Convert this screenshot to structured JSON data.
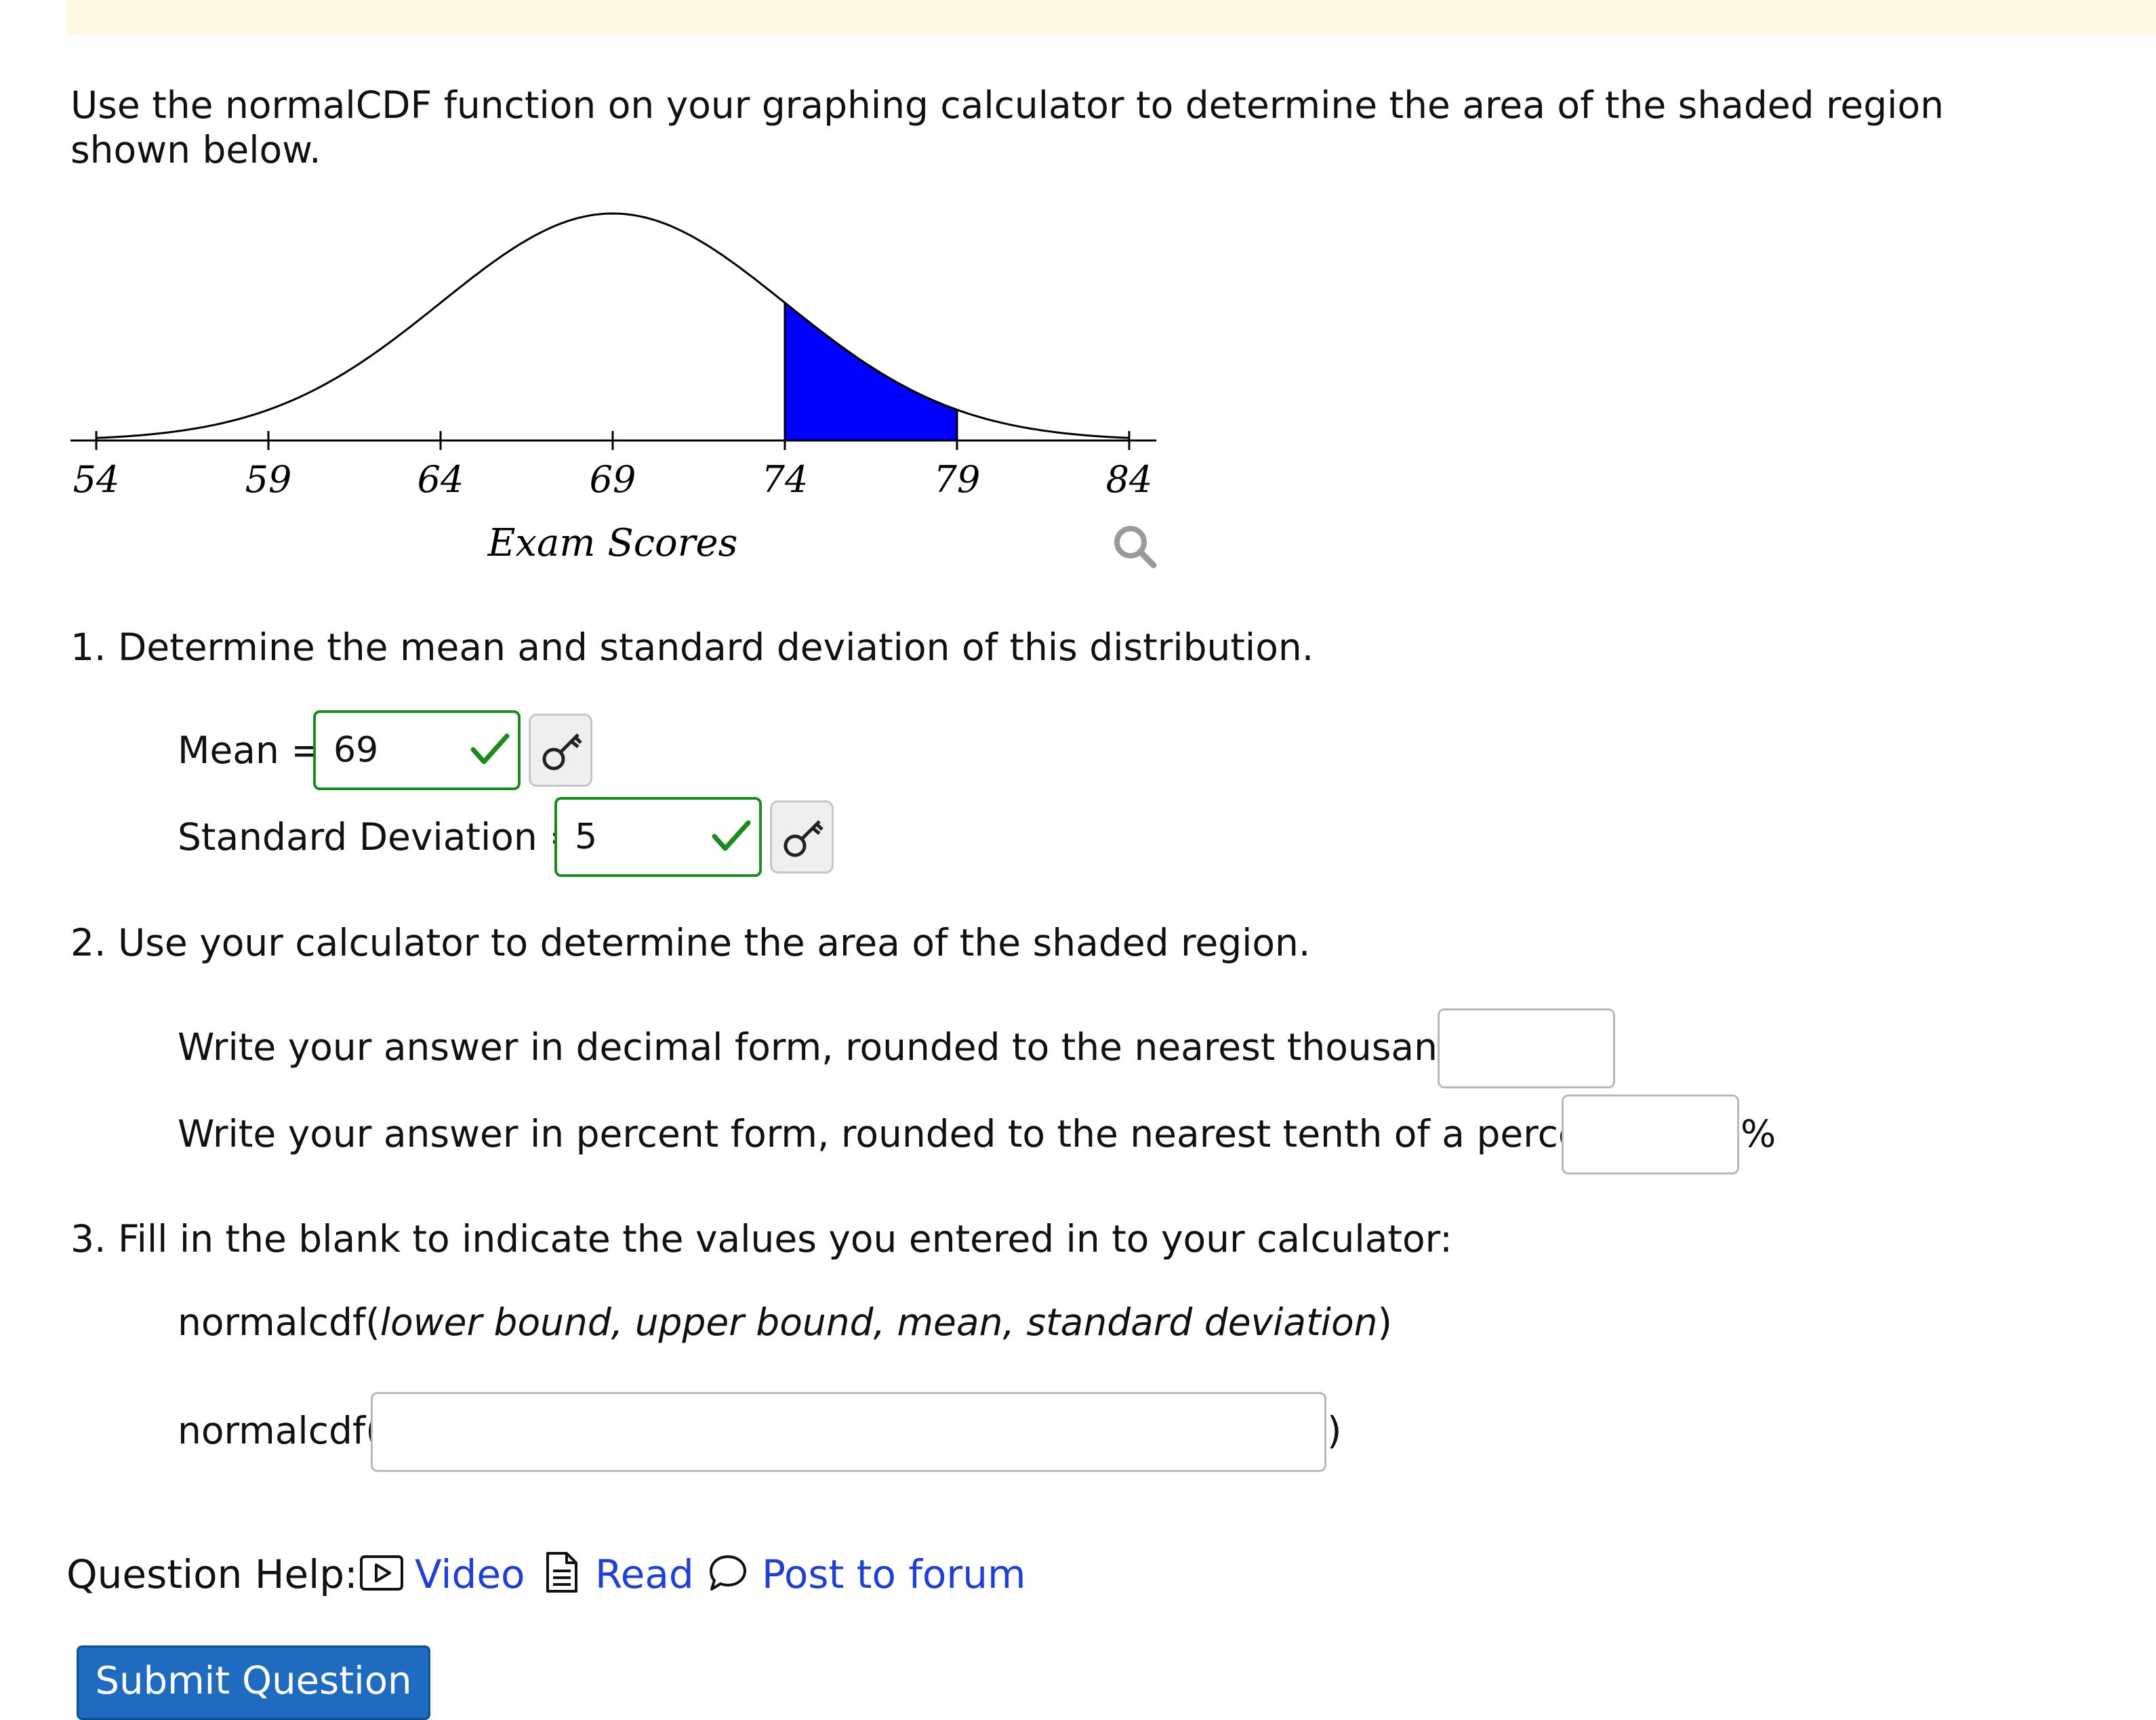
{
  "intro": "Use the normalCDF function on your graphing calculator to determine the area of the shaded region shown below.",
  "chart_data": {
    "type": "area",
    "distribution": "normal",
    "mean": 69,
    "sd": 5,
    "xlim": [
      54,
      84
    ],
    "ticks": [
      "54",
      "59",
      "64",
      "69",
      "74",
      "79",
      "84"
    ],
    "shaded_range": [
      74,
      79
    ],
    "shade_color": "#0000ff",
    "xlabel": "Exam Scores"
  },
  "q1": {
    "heading": "1. Determine the mean and standard deviation of this distribution.",
    "mean_label": "Mean =",
    "mean_value": "69",
    "sd_label": "Standard Deviation =",
    "sd_value": "5"
  },
  "q2": {
    "heading": "2. Use your calculator to determine the area of the shaded region.",
    "decimal_label": "Write your answer in decimal form, rounded to the nearest thousandth:",
    "decimal_value": "",
    "percent_label": "Write your answer in percent form, rounded to the nearest tenth of a percent:",
    "percent_value": "",
    "percent_suffix": "%"
  },
  "q3": {
    "heading": "3. Fill in the blank to indicate the values you entered in to your calculator:",
    "syntax_prefix": "normalcdf(",
    "syntax_args": "lower bound, upper bound, mean, standard deviation",
    "syntax_suffix": ")",
    "input_prefix": "normalcdf(",
    "input_value": "",
    "input_suffix": ")"
  },
  "help": {
    "label": "Question Help:",
    "video": "Video",
    "read": "Read",
    "forum": "Post to forum"
  },
  "submit_label": "Submit Question",
  "colors": {
    "correct": "#1d8a1d",
    "link": "#1f3fd6",
    "submit": "#1e6bbf",
    "banner": "#fff9e3"
  }
}
